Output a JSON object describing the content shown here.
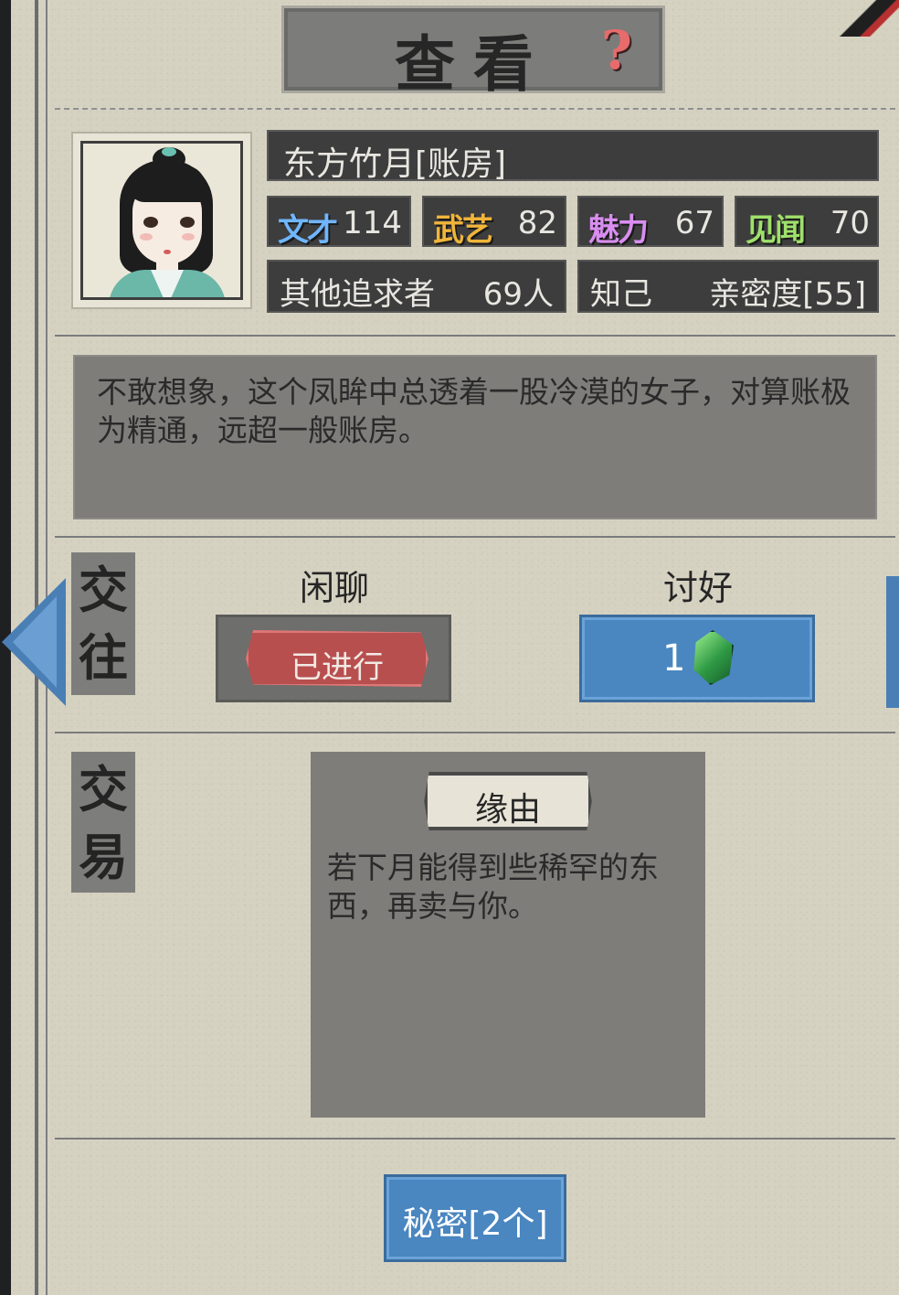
{
  "header": {
    "title": "查看",
    "help_icon": "?"
  },
  "character": {
    "name": "东方竹月[账房]",
    "stats": [
      {
        "label": "文才",
        "value": "114",
        "color": "#6fb6ff"
      },
      {
        "label": "武艺",
        "value": "82",
        "color": "#f0b53a"
      },
      {
        "label": "魅力",
        "value": "67",
        "color": "#d98ef0"
      },
      {
        "label": "见闻",
        "value": "70",
        "color": "#9fe06b"
      }
    ],
    "suitors_label": "其他追求者",
    "suitors_value": "69人",
    "relation_label": "知己",
    "intimacy": "亲密度[55]",
    "description": "不敢想象，这个凤眸中总透着一股冷漠的女子，对算账极为精通，远超一般账房。"
  },
  "interact": {
    "tag": "交往",
    "chat_label": "闲聊",
    "chat_status": "已进行",
    "please_label": "讨好",
    "please_cost": "1",
    "gem_icon": "green-gem-icon"
  },
  "trade": {
    "tag": "交易",
    "reason_label": "缘由",
    "reason_text": "若下月能得到些稀罕的东西，再卖与你。"
  },
  "footer": {
    "secret_button": "秘密[2个]"
  }
}
